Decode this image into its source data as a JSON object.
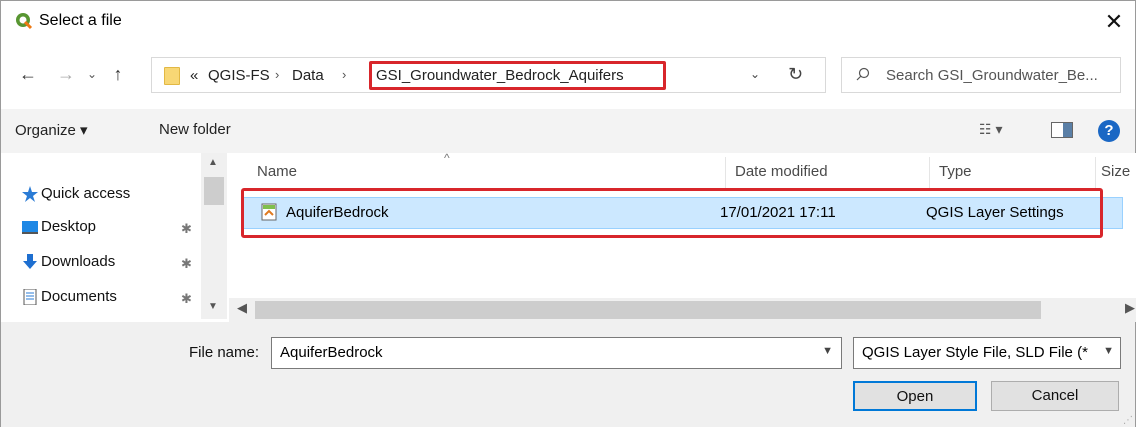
{
  "window": {
    "title": "Select a file",
    "close_glyph": "✕"
  },
  "nav": {
    "back_glyph": "←",
    "forward_glyph": "→",
    "recent_glyph": "⌄",
    "up_glyph": "↑",
    "breadcrumb_prefix": "«",
    "breadcrumbs": [
      "QGIS-FS",
      "Data",
      "GSI_Groundwater_Bedrock_Aquifers"
    ],
    "sep_glyph": "›",
    "dropdown_glyph": "⌄",
    "refresh_glyph": "↻"
  },
  "search": {
    "placeholder": "Search GSI_Groundwater_Be..."
  },
  "toolbar": {
    "organize_label": "Organize ▾",
    "new_folder_label": "New folder",
    "view_glyph": "☷ ▾",
    "help_glyph": "?"
  },
  "sidebar": {
    "items": [
      {
        "label": "Quick access",
        "icon": "star-icon"
      },
      {
        "label": "Desktop",
        "icon": "desktop-icon",
        "pinned": true
      },
      {
        "label": "Downloads",
        "icon": "download-icon",
        "pinned": true
      },
      {
        "label": "Documents",
        "icon": "documents-icon",
        "pinned": true
      }
    ],
    "pin_glyph": "✱"
  },
  "file_list": {
    "columns": [
      "Name",
      "Date modified",
      "Type",
      "Size"
    ],
    "sort_glyph": "^",
    "rows": [
      {
        "name": "AquiferBedrock",
        "date": "17/01/2021 17:11",
        "type": "QGIS Layer Settings",
        "selected": true
      }
    ]
  },
  "bottom": {
    "file_name_label": "File name:",
    "file_name_value": "AquiferBedrock",
    "filter_value": "QGIS Layer Style File, SLD File (*",
    "open_label": "Open",
    "cancel_label": "Cancel"
  },
  "colors": {
    "highlight": "#d8262b",
    "selection": "#cce8ff",
    "accent": "#0078d7"
  }
}
